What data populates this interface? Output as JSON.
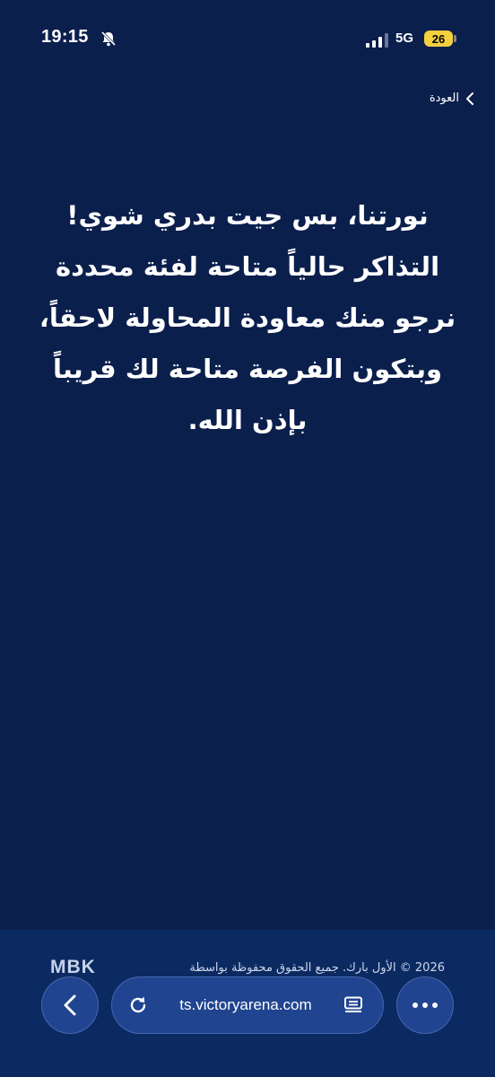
{
  "status_bar": {
    "time": "19:15",
    "network": "5G",
    "battery_level": "26",
    "icons": [
      "bell-slash-icon",
      "signal-icon"
    ]
  },
  "header": {
    "back_label": "العودة",
    "back_icon": "chevron-right-icon"
  },
  "message": {
    "lines": [
      "نورتنا، بس جيت بدري شوي!",
      "التذاكر حالياً متاحة لفئة محددة",
      "نرجو منك معاودة المحاولة لاحقاً،",
      "وبتكون الفرصة متاحة لك قريباً",
      "بإذن الله."
    ]
  },
  "footer": {
    "copyright": "2026 © الأول بارك. جميع الحقوق محفوظة  بواسطة",
    "logo_text": "MBK"
  },
  "browser": {
    "url": "ts.victoryarena.com",
    "back_icon": "chevron-left-icon",
    "reload_icon": "reload-icon",
    "reader_icon": "reader-mode-icon",
    "more_icon": "more-dots-icon"
  },
  "colors": {
    "background": "#0b1f4d",
    "panel": "#0c2a62",
    "text": "#ffffff",
    "battery": "#f4d03f"
  }
}
